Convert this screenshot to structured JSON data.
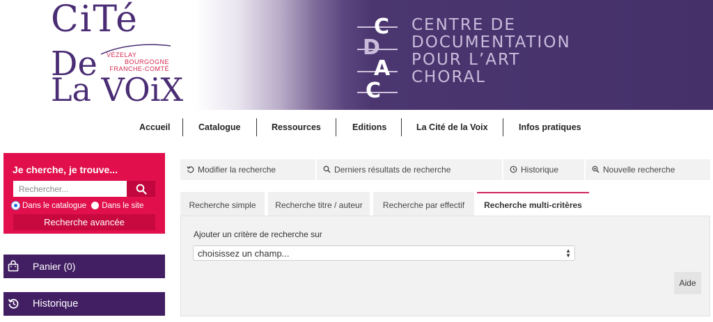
{
  "banner": {
    "logo": {
      "cite": "CiTé",
      "de": "De",
      "lavoix": "La VOiX",
      "sub": [
        "VÉZELAY",
        "BOURGOGNE",
        "FRANCHE-COMTÉ"
      ]
    },
    "cdac_letters": [
      "C",
      "D",
      "A",
      "C"
    ],
    "centre_lines": [
      "CENTRE DE",
      "DOCUMENTATION",
      "POUR L’ART",
      "CHORAL"
    ]
  },
  "nav": {
    "items": [
      "Accueil",
      "Catalogue",
      "Ressources",
      "Editions",
      "La Cité de la Voix",
      "Infos pratiques"
    ]
  },
  "search": {
    "title": "Je cherche, je trouve...",
    "placeholder": "Rechercher...",
    "option_catalogue": "Dans le catalogue",
    "option_site": "Dans le site",
    "advanced_label": "Recherche avancée"
  },
  "panier": {
    "label": "Panier (0)"
  },
  "historique_side": {
    "label": "Historique"
  },
  "toolbar": {
    "modify": "Modifier la recherche",
    "last_results": "Derniers résultats de recherche",
    "history": "Historique",
    "new_search": "Nouvelle recherche"
  },
  "tabs": [
    "Recherche simple",
    "Recherche titre / auteur",
    "Recherche par effectif",
    "Recherche multi-critères"
  ],
  "panel": {
    "label": "Ajouter un critère de recherche sur",
    "select_value": "choisissez un champ...",
    "help": "Aide"
  },
  "colors": {
    "brand_purple": "#421f63",
    "brand_pink": "#e10f4b",
    "active_tab_border": "#d1245b"
  }
}
